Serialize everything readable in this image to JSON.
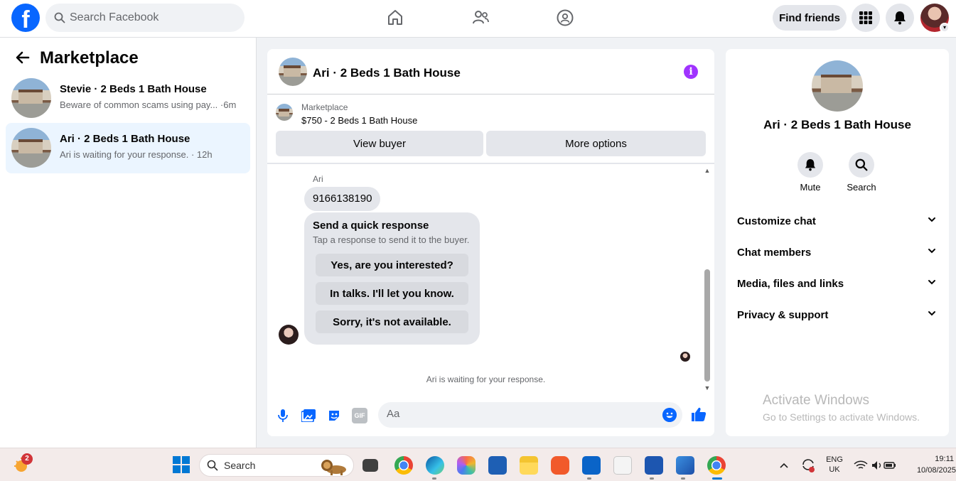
{
  "topbar": {
    "logo_letter": "f",
    "search_placeholder": "Search Facebook",
    "find_friends_label": "Find friends"
  },
  "left_panel": {
    "title": "Marketplace",
    "conversations": [
      {
        "title": "Stevie · 2 Beds 1 Bath House",
        "subtitle": "Beware of common scams using pay... ·6m",
        "active": false
      },
      {
        "title": "Ari · 2 Beds 1 Bath House",
        "subtitle": "Ari is waiting for your response. · 12h",
        "active": true
      }
    ]
  },
  "chat": {
    "header_title": "Ari · 2 Beds 1 Bath House",
    "info_glyph": "i",
    "listing_label": "Marketplace",
    "listing_price": "$750 - 2 Beds 1 Bath House",
    "view_buyer_label": "View buyer",
    "more_options_label": "More options",
    "sender_name": "Ari",
    "phone_message": "9166138190",
    "quick_response": {
      "title": "Send a quick response",
      "subtitle": "Tap a response to send it to the buyer.",
      "options": [
        "Yes, are you interested?",
        "In talks. I'll let you know.",
        "Sorry, it's not available."
      ]
    },
    "waiting_text": "Ari is waiting for your response.",
    "composer_placeholder": "Aa",
    "gif_label": "GIF"
  },
  "right_panel": {
    "title": "Ari · 2 Beds 1 Bath House",
    "mute_label": "Mute",
    "search_label": "Search",
    "sections": [
      "Customize chat",
      "Chat members",
      "Media, files and links",
      "Privacy & support"
    ],
    "watermark_title": "Activate Windows",
    "watermark_sub": "Go to Settings to activate Windows."
  },
  "taskbar": {
    "weather_badge": "2",
    "search_label": "Search",
    "lang_top": "ENG",
    "lang_bottom": "UK",
    "time": "19:11",
    "date": "10/08/2025"
  },
  "colors": {
    "facebook_blue": "#0866ff",
    "active_conversation": "#ebf5ff",
    "info_purple": "#a033ff",
    "bubble_gray": "#e4e6eb"
  }
}
